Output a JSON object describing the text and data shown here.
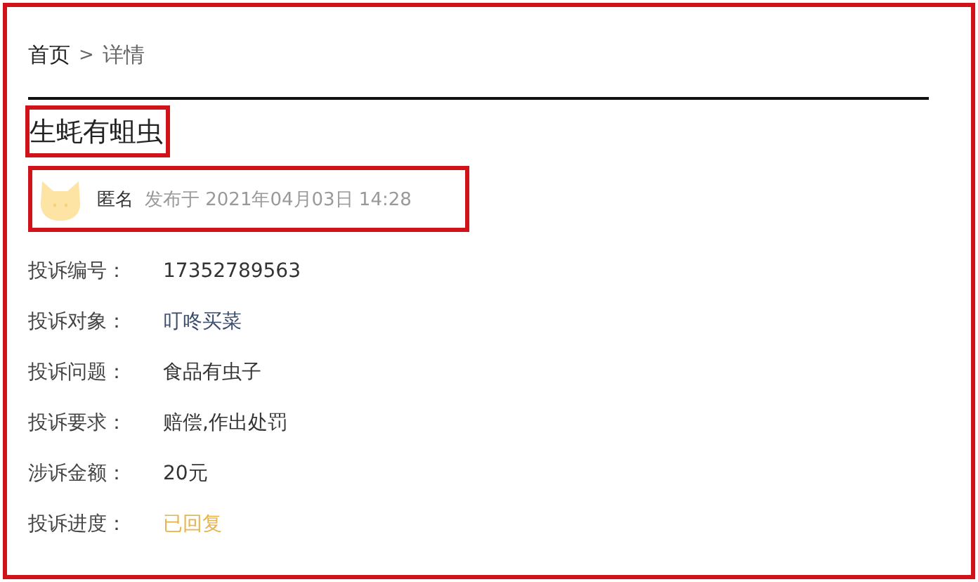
{
  "breadcrumb": [
    {
      "label": "首页",
      "kind": "link"
    },
    {
      "label": ">",
      "kind": "separator"
    },
    {
      "label": "详情",
      "kind": "current"
    }
  ],
  "title": "生蚝有蛆虫",
  "author": {
    "name": "匿名",
    "published": "发布于 2021年04月03日 14:28"
  },
  "fields": [
    {
      "label": "投诉编号：",
      "value": "17352789563",
      "kind": "plain"
    },
    {
      "label": "投诉对象：",
      "value": "叮咚买菜",
      "kind": "link"
    },
    {
      "label": "投诉问题：",
      "value": "食品有虫子",
      "kind": "plain"
    },
    {
      "label": "投诉要求：",
      "value": "赔偿,作出处罚",
      "kind": "plain"
    },
    {
      "label": "涉诉金额：",
      "value": "20元",
      "kind": "plain"
    },
    {
      "label": "投诉进度：",
      "value": "已回复",
      "kind": "status"
    }
  ]
}
